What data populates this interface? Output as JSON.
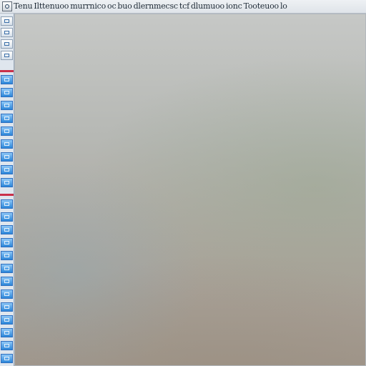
{
  "menu": {
    "app_icon": "app-logo-icon",
    "items": [
      "Tenu",
      "Ilttenuoo",
      "murrnico",
      "oc",
      "buo",
      "dlernmecsc",
      "tcf",
      "dlumuoo",
      "ionc",
      "Tooteuoo",
      "lo"
    ]
  },
  "toolstrip": {
    "tool_icon": "tool-icon"
  },
  "colors": {
    "tool_accent": "#2b86d9",
    "divider_accent": "#c9304a",
    "toolbar_bg": "#e7ebef",
    "canvas_bg": "#b6b8b4"
  }
}
